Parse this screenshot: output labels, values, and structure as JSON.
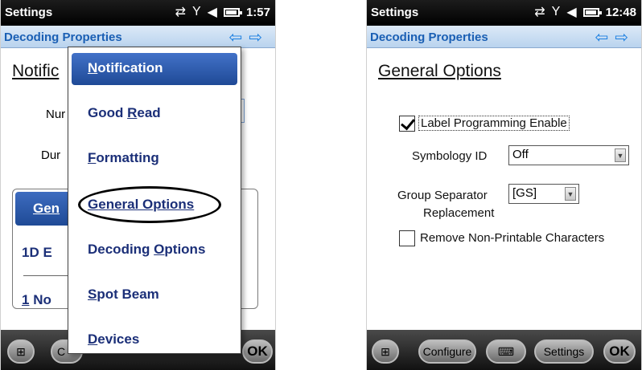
{
  "left": {
    "statusbar": {
      "title": "Settings",
      "time": "1:57"
    },
    "subheader": {
      "title": "Decoding Properties",
      "back_arrow": "⇦",
      "fwd_arrow": "⇨"
    },
    "page_title": "Notific",
    "field_label_1": "Nur",
    "field_label_2": "Dur",
    "tabs": {
      "active": "Gen",
      "item_1": "1D E",
      "item_2_u": "1",
      "item_2": " No"
    },
    "menu": {
      "items": [
        {
          "u": "N",
          "rest": "otification"
        },
        {
          "pre": "Good ",
          "u": "R",
          "rest": "ead"
        },
        {
          "u": "F",
          "rest": "ormatting"
        },
        {
          "u": "G",
          "rest": "eneral Options"
        },
        {
          "pre": "Decoding ",
          "u": "O",
          "rest": "ptions"
        },
        {
          "u": "S",
          "rest": "pot Beam"
        },
        {
          "u": "D",
          "rest": "evices"
        }
      ]
    },
    "bottombar": {
      "btn2": "C",
      "ok": "OK"
    }
  },
  "right": {
    "statusbar": {
      "title": "Settings",
      "time": "12:48"
    },
    "subheader": {
      "title": "Decoding Properties",
      "back_arrow": "⇦",
      "fwd_arrow": "⇨"
    },
    "page_title": "General Options",
    "label_programming": {
      "label": "Label Programming Enable",
      "checked": true
    },
    "symbology_id": {
      "label": "Symbology ID",
      "value": "Off"
    },
    "group_separator": {
      "label_line1": "Group Separator",
      "label_line2": "Replacement",
      "value": "[GS]"
    },
    "remove_nonprintable": {
      "label": "Remove Non-Printable Characters",
      "checked": false
    },
    "bottombar": {
      "configure": "Configure",
      "settings": "Settings",
      "ok": "OK"
    }
  },
  "colors": {
    "accent": "#1f4a96",
    "link": "#1b2f78",
    "subheader_text": "#1a5fb4"
  }
}
